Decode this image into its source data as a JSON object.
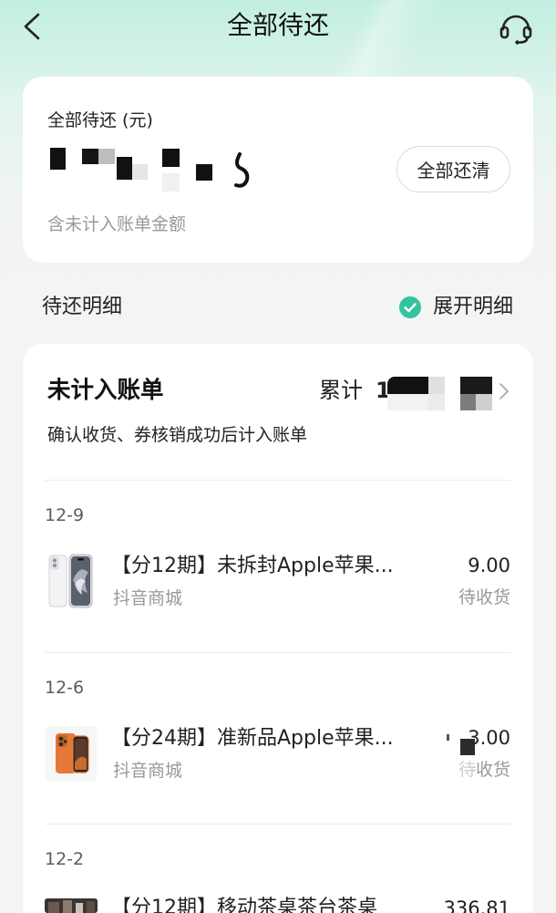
{
  "header": {
    "title": "全部待还",
    "back_icon": "chevron-left-icon",
    "service_icon": "headset-icon"
  },
  "summary": {
    "label": "全部待还 (元)",
    "pay_all_label": "全部还清",
    "note": "含未计入账单金额"
  },
  "details": {
    "title": "待还明细",
    "expand_label": "展开明细",
    "expand_icon": "check-circle-icon",
    "expand_checked": true
  },
  "unbilled": {
    "title": "未计入账单",
    "total_label": "累计",
    "total_visible": "1",
    "chevron_icon": "chevron-right-icon",
    "note": "确认收货、券核销成功后计入账单"
  },
  "groups": [
    {
      "date": "12-9",
      "items": [
        {
          "title": "【分12期】未拆封Apple苹果...",
          "shop": "抖音商城",
          "amount": "9.00",
          "status": "待收货"
        }
      ]
    },
    {
      "date": "12-6",
      "items": [
        {
          "title": "【分24期】准新品Apple苹果...",
          "shop": "抖音商城",
          "amount": "3.00",
          "status": "待收货"
        }
      ]
    },
    {
      "date": "12-2",
      "items": [
        {
          "title": "【分12期】移动茶桌茶台茶桌",
          "amount": "336.81"
        }
      ]
    }
  ],
  "colors": {
    "accent": "#33c49e",
    "header_mint": "#c2eee0",
    "page_bg": "#f4f4f4",
    "text": "#222222",
    "muted": "#999999"
  }
}
